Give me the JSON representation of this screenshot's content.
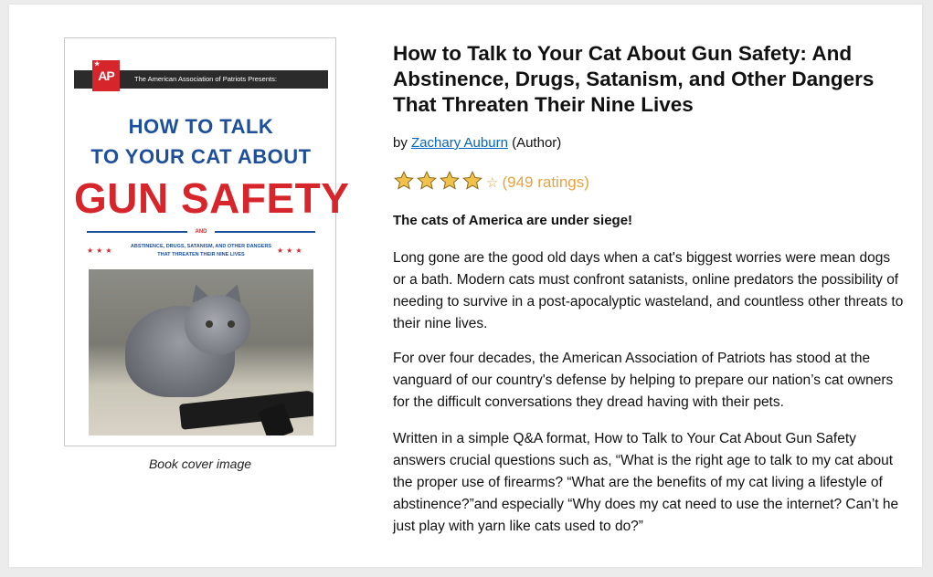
{
  "cover": {
    "publisher_line": "The American Association of Patriots Presents:",
    "logo_text": "AP",
    "line1": "HOW TO TALK",
    "line2": "TO YOUR CAT ABOUT",
    "big": "GUN SAFETY",
    "and": "AND",
    "subtitle": "ABSTINENCE, DRUGS, SATANISM, AND OTHER DANGERS THAT THREATEN THEIR NINE LIVES",
    "caption": "Book cover image"
  },
  "product": {
    "title": "How to Talk to Your Cat About Gun Safety: And Abstinence, Drugs, Satanism, and Other Dangers That Threaten Their Nine Lives",
    "by": "by ",
    "author": "Zachary Auburn",
    "author_role": " (Author)",
    "rating_count": "(949 ratings)",
    "rating_stars": 4,
    "star_color": "#f0c14b",
    "rating_text_color": "#e8a33d"
  },
  "description": {
    "tagline": "The cats of America are under siege!",
    "p1": "Long gone are the good old days when a cat's biggest worries were mean dogs or a bath. Modern cats must confront satanists, online predators the possibility of needing to survive in a post-apocalyptic wasteland, and countless other threats to their nine lives.",
    "p2": "For over four decades, the American Association of Patriots has stood at the vanguard of our country's defense by helping to prepare our nation’s cat owners for the difficult conversations they dread having with their pets.",
    "p3": "Written in a simple Q&A format, How to Talk to Your Cat About Gun Safety answers crucial questions such as, “What is the right age to talk to my cat about the proper use of firearms? “What are the benefits of my cat living a lifestyle of abstinence?”and especially “Why does my cat need to use the internet? Can’t he just play with yarn like cats used to do?”"
  }
}
